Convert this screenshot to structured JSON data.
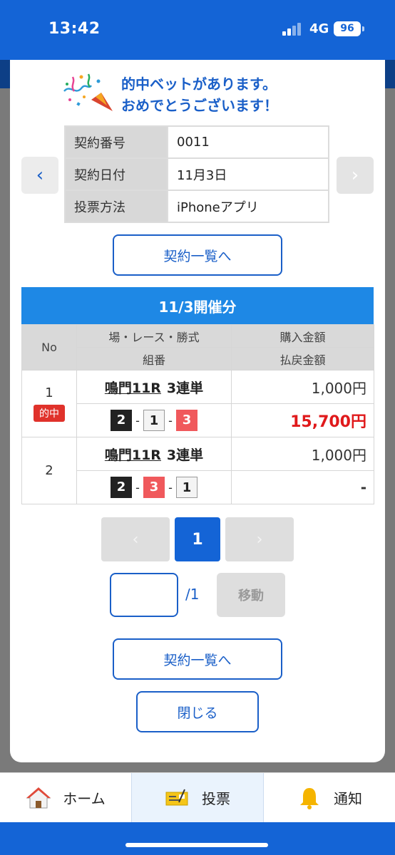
{
  "status_bar": {
    "time": "13:42",
    "network": "4G",
    "battery": "96"
  },
  "banner": {
    "line1": "的中ベットがあります。",
    "line2": "おめでとうございます！"
  },
  "contract": {
    "rows": [
      {
        "key": "契約番号",
        "value": "0011"
      },
      {
        "key": "契約日付",
        "value": "11月3日"
      },
      {
        "key": "投票方法",
        "value": "iPhoneアプリ"
      }
    ]
  },
  "buttons": {
    "contract_list": "契約一覧へ",
    "close": "閉じる",
    "goto": "移動"
  },
  "session_header": "11/3開催分",
  "table_headers": {
    "no": "No",
    "race": "場・レース・勝式",
    "purchase": "購入金額",
    "combo": "組番",
    "payout": "払戻金額"
  },
  "bets": [
    {
      "no": "1",
      "hit_label": "的中",
      "venue_race": "鳴門11R",
      "bet_type": "3連単",
      "combo": [
        "2",
        "1",
        "3"
      ],
      "purchase": "1,000円",
      "payout": "15,700円"
    },
    {
      "no": "2",
      "hit_label": "",
      "venue_race": "鳴門11R",
      "bet_type": "3連単",
      "combo": [
        "2",
        "3",
        "1"
      ],
      "purchase": "1,000円",
      "payout": "-"
    }
  ],
  "pagination": {
    "prev": "‹",
    "current": "1",
    "next": "›",
    "total": "/1",
    "input_value": ""
  },
  "tabbar": [
    {
      "label": "ホーム",
      "icon": "home-icon"
    },
    {
      "label": "投票",
      "icon": "ticket-icon"
    },
    {
      "label": "通知",
      "icon": "bell-icon"
    }
  ],
  "colors": {
    "primary": "#1464d6",
    "accent": "#1e88e5",
    "hit": "#e0322b",
    "payout_win": "#e0191b"
  }
}
